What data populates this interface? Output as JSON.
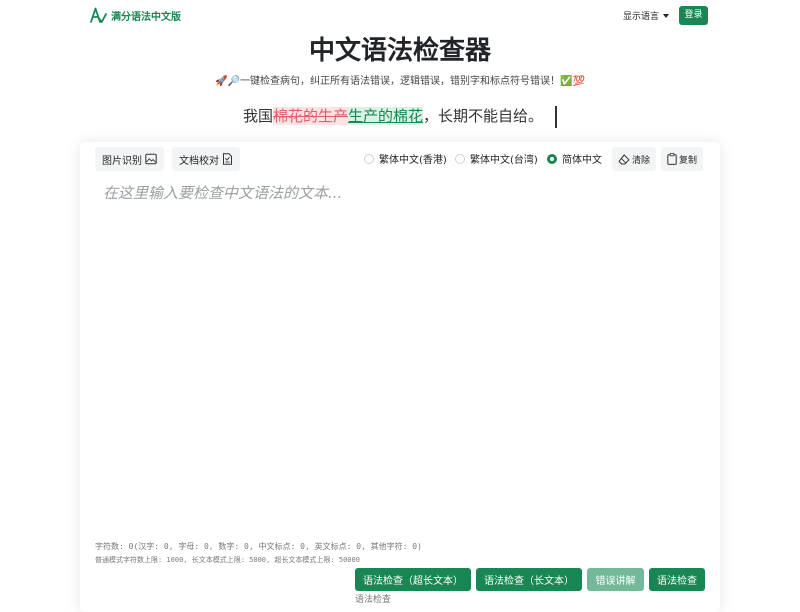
{
  "navbar": {
    "brand_name": "满分语法中文版",
    "language_toggle": "显示语言",
    "login_label": "登录"
  },
  "hero": {
    "title": "中文语法检查器",
    "subtitle_icons": "🚀🔎",
    "subtitle_text": "一键检查病句，纠正所有语法错误，逻辑错误，错别字和标点符号错误！",
    "subtitle_check": "✅",
    "subtitle_hundred": "💯",
    "demo": {
      "prefix": "我国",
      "wrong": "棉花的生产",
      "correct": "生产的棉花",
      "suffix": "，长期不能自给。"
    }
  },
  "toolbar": {
    "image_ocr_label": "图片识别",
    "doc_check_label": "文档校对",
    "radio_options": [
      {
        "label": "繁体中文(香港)",
        "checked": false
      },
      {
        "label": "繁体中文(台湾)",
        "checked": false
      },
      {
        "label": "简体中文",
        "checked": true
      }
    ],
    "clear_label": "清除",
    "copy_label": "复制"
  },
  "editor": {
    "value": "",
    "placeholder": "在这里输入要检查中文语法的文本..."
  },
  "stats": {
    "line": "字符数: 0(汉字: 0, 字母: 0, 数字: 0, 中文标点: 0, 英文标点: 0, 其他字符: 0)",
    "limits": "普通模式字符数上限: 1000, 长文本模式上限: 5000, 超长文本模式上限: 50000"
  },
  "actions": {
    "check_ultra_long": "语法检查（超长文本）",
    "check_long": "语法检查（长文本）",
    "explain_errors": "错误讲解",
    "check": "语法检查",
    "footer_caption": "语法检查"
  },
  "colors": {
    "brand": "#198754",
    "explain_button": "#74b89a",
    "error_text": "#e35d6a",
    "error_bg": "#fde2e4",
    "correct_bg": "#d9f2e3"
  }
}
